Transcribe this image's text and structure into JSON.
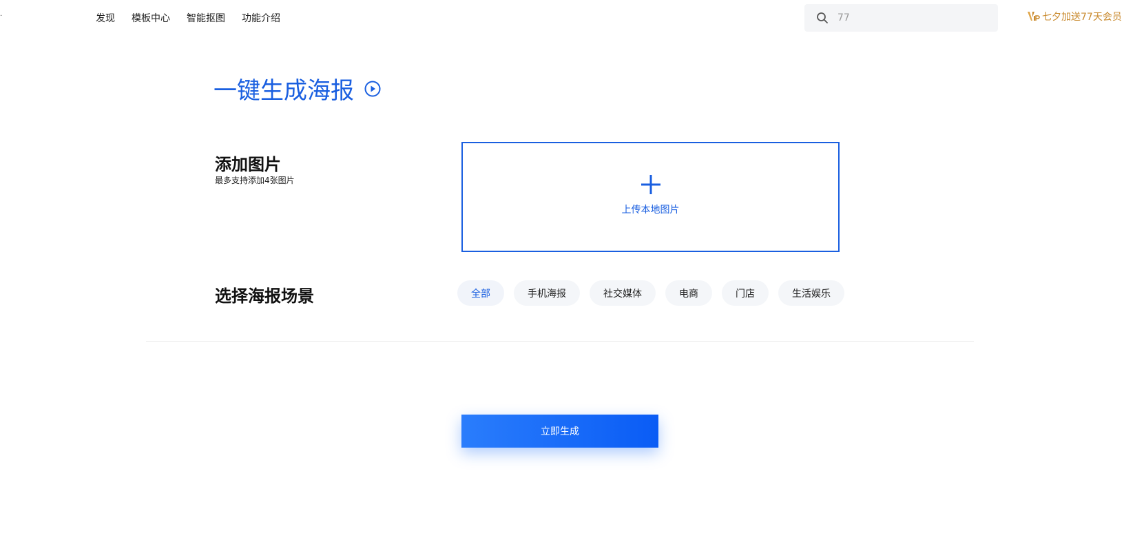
{
  "nav": {
    "edge_mark": "·",
    "items": [
      {
        "label": "发现"
      },
      {
        "label": "模板中心"
      },
      {
        "label": "智能抠图"
      },
      {
        "label": "功能介绍"
      }
    ]
  },
  "search": {
    "value": "77",
    "icon": "search-icon"
  },
  "vip": {
    "label": "七夕加送77天会员",
    "icon": "vip-icon",
    "color": "#c98a2e"
  },
  "page": {
    "title": "一键生成海报",
    "play_icon": "play-circle-icon",
    "accent_color": "#1a5fe0"
  },
  "add_image": {
    "title": "添加图片",
    "subtitle": "最多支持添加4张图片",
    "upload_label": "上传本地图片",
    "upload_icon": "plus-icon"
  },
  "scene": {
    "title": "选择海报场景",
    "chips": [
      {
        "label": "全部",
        "active": true
      },
      {
        "label": "手机海报",
        "active": false
      },
      {
        "label": "社交媒体",
        "active": false
      },
      {
        "label": "电商",
        "active": false
      },
      {
        "label": "门店",
        "active": false
      },
      {
        "label": "生活娱乐",
        "active": false
      }
    ]
  },
  "generate": {
    "label": "立即生成"
  }
}
